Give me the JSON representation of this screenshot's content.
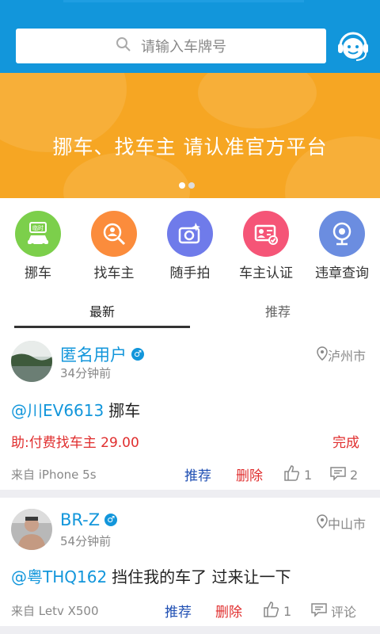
{
  "search": {
    "placeholder": "请输入车牌号"
  },
  "banner": {
    "text": "挪车、找车主   请认准官方平台",
    "page_index": 1,
    "page_count": 2
  },
  "quick_actions": [
    {
      "label": "挪车",
      "color": "#7ccf4b",
      "icon": "move-car-icon"
    },
    {
      "label": "找车主",
      "color": "#fb8c3c",
      "icon": "find-owner-icon"
    },
    {
      "label": "随手拍",
      "color": "#6f7bea",
      "icon": "camera-icon"
    },
    {
      "label": "车主认证",
      "color": "#f55577",
      "icon": "id-card-icon"
    },
    {
      "label": "违章查询",
      "color": "#6b8de0",
      "icon": "webcam-icon"
    }
  ],
  "tabs": [
    {
      "label": "最新",
      "active": true
    },
    {
      "label": "推荐",
      "active": false
    }
  ],
  "posts": [
    {
      "username": "匿名用户",
      "gender": "♂",
      "time": "34分钟前",
      "location": "泸州市",
      "plate": "@川EV6613",
      "text": "挪车",
      "reward": "助:付费找车主 29.00",
      "status": "完成",
      "source": "来自  iPhone 5s",
      "recommend": "推荐",
      "delete": "删除",
      "likes": "1",
      "comments": "2"
    },
    {
      "username": "BR-Z",
      "gender": "♂",
      "time": "54分钟前",
      "location": "中山市",
      "plate": "@粤THQ162",
      "text": "挡住我的车了 过来让一下",
      "source": "来自  Letv X500",
      "recommend": "推荐",
      "delete": "删除",
      "likes": "1",
      "comments": "评论"
    }
  ],
  "colors": {
    "primary": "#1296db",
    "banner": "#f6a623",
    "danger": "#e02e2e",
    "link": "#1f4fb3"
  }
}
